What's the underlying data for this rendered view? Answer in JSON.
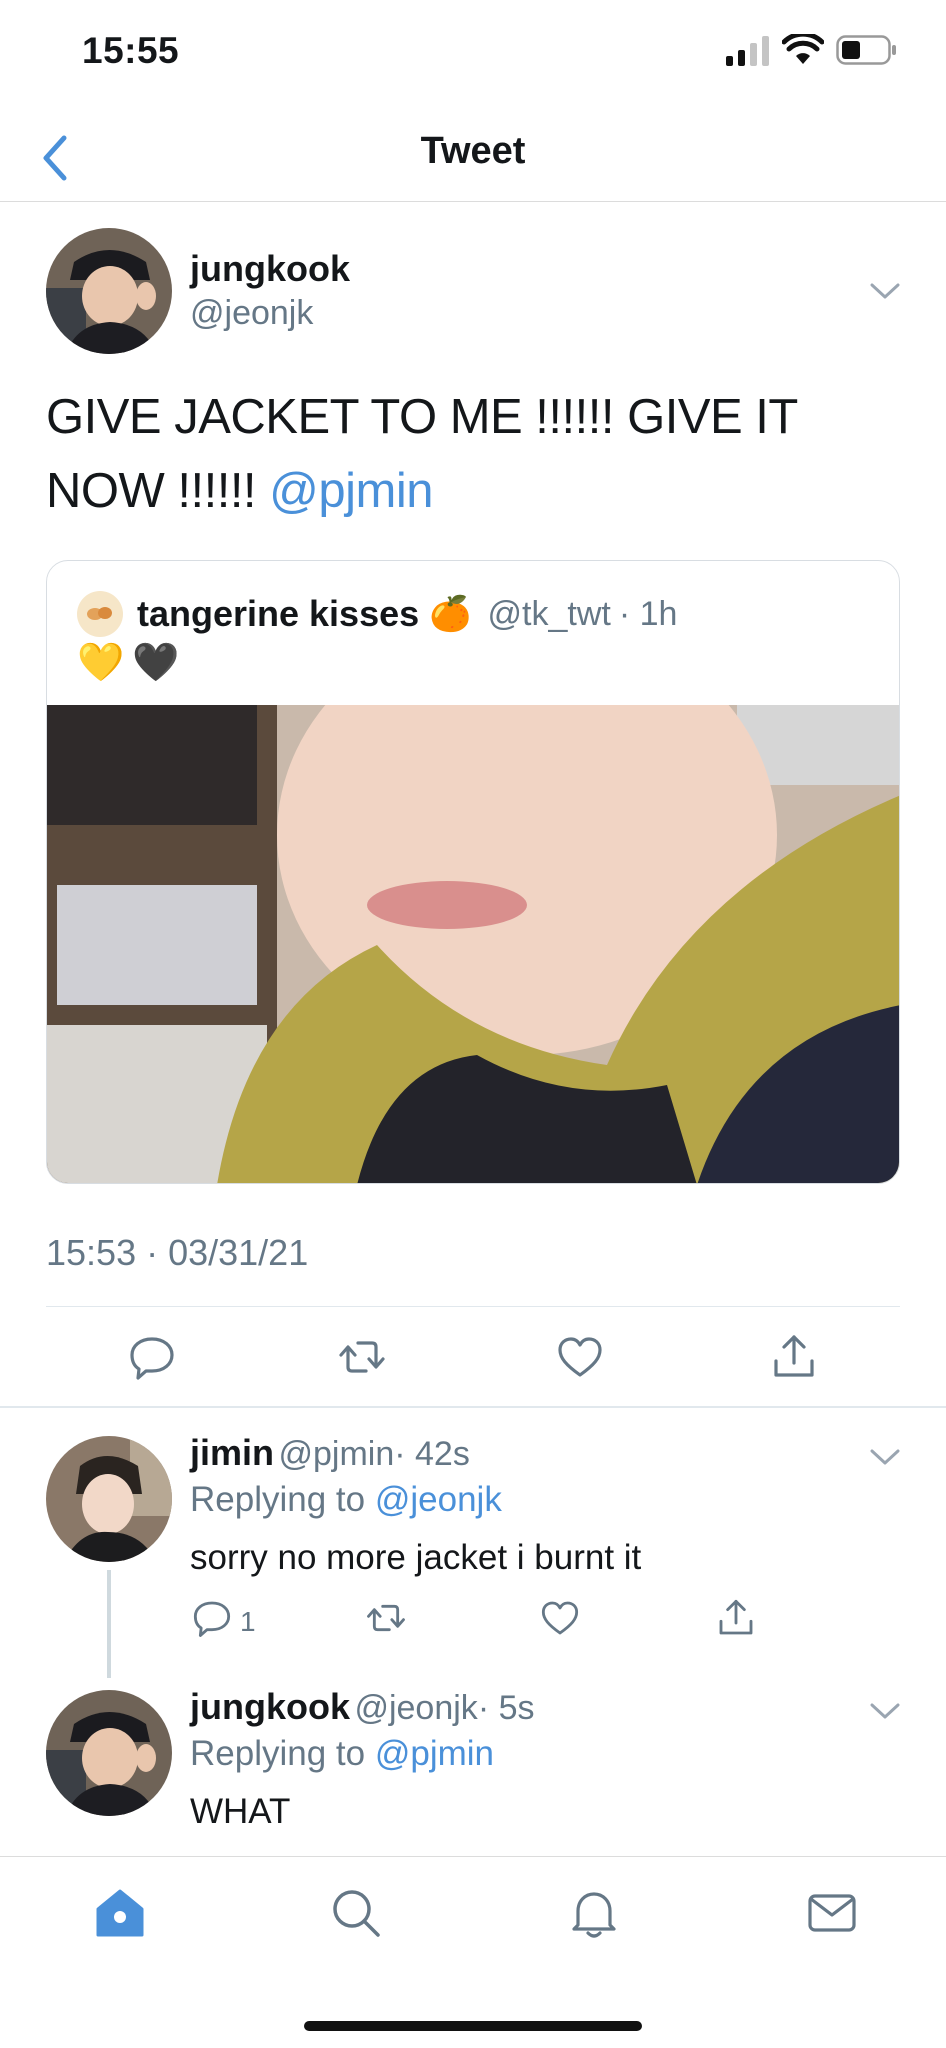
{
  "status": {
    "time": "15:55"
  },
  "nav": {
    "title": "Tweet"
  },
  "tweet": {
    "name": "jungkook",
    "handle": "@jeonjk",
    "text_line1": "GIVE JACKET TO ME !!!!!! GIVE IT",
    "text_line2": "NOW !!!!!!",
    "mention": "@pjmin",
    "timestamp": "15:53 · 03/31/21"
  },
  "quote": {
    "name": "tangerine kisses",
    "name_emoji": "🍊",
    "handle": "@tk_twt",
    "time": "· 1h",
    "emojis": [
      "💛",
      "🖤"
    ]
  },
  "replies": [
    {
      "name": "jimin",
      "handle": "@pjmin",
      "time": "· 42s",
      "replying_prefix": "Replying to",
      "replying_to": "@jeonjk",
      "text": "sorry no more jacket i burnt it",
      "reply_count": "1"
    },
    {
      "name": "jungkook",
      "handle": "@jeonjk",
      "time": "· 5s",
      "replying_prefix": "Replying to",
      "replying_to": "@pjmin",
      "text": "WHAT"
    }
  ],
  "icons": {
    "back": "chevron-left-icon",
    "more": "chevron-down-icon",
    "reply": "reply-icon",
    "retweet": "retweet-icon",
    "like": "heart-icon",
    "share": "share-icon",
    "home": "home-icon",
    "search": "search-icon",
    "notifications": "bell-icon",
    "messages": "mail-icon"
  },
  "colors": {
    "accent": "#4a90d9",
    "muted": "#657786",
    "divider": "#e1e8ed"
  }
}
